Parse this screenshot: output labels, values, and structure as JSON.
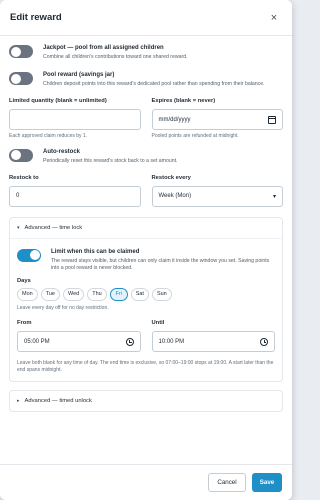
{
  "dialog": {
    "title": "Edit reward",
    "close_glyph": "×"
  },
  "jackpot": {
    "label": "Jackpot — pool from all assigned children",
    "description": "Combine all children's contributions toward one shared reward.",
    "on": false
  },
  "pool": {
    "label": "Pool reward (savings jar)",
    "description": "Children deposit points into this reward's dedicated pool rather than spending from their balance.",
    "on": false
  },
  "limited": {
    "label": "Limited quantity (blank = unlimited)",
    "value": "",
    "hint": "Each approved claim reduces by 1."
  },
  "expires": {
    "label": "Expires (blank = never)",
    "value": "mm/dd/yyyy",
    "hint": "Pooled points are refunded at midnight."
  },
  "autorestock": {
    "label": "Auto-restock",
    "description": "Periodically reset this reward's stock back to a set amount.",
    "on": false
  },
  "restock_to": {
    "label": "Restock to",
    "value": "0"
  },
  "restock_every": {
    "label": "Restock every",
    "value": "Week (Mon)"
  },
  "time_lock": {
    "header": "Advanced — time lock",
    "limit_label": "Limit when this can be claimed",
    "limit_description": "The reward stays visible, but children can only claim it inside the window you set. Saving points into a pool reward is never blocked.",
    "limit_on": true,
    "days_label": "Days",
    "days": [
      {
        "label": "Mon",
        "selected": false
      },
      {
        "label": "Tue",
        "selected": false
      },
      {
        "label": "Wed",
        "selected": false
      },
      {
        "label": "Thu",
        "selected": false
      },
      {
        "label": "Fri",
        "selected": true
      },
      {
        "label": "Sat",
        "selected": false
      },
      {
        "label": "Sun",
        "selected": false
      }
    ],
    "days_hint": "Leave every day off for no day restriction.",
    "from_label": "From",
    "from_value": "05:00 PM",
    "until_label": "Until",
    "until_value": "10:00 PM",
    "window_hint": "Leave both blank for any time of day. The end time is exclusive, so 07:00–19:00 stops at 19:00. A start later than the end spans midnight."
  },
  "timed_unlock": {
    "header": "Advanced — timed unlock"
  },
  "footer": {
    "cancel": "Cancel",
    "save": "Save"
  },
  "colors": {
    "accent": "#1e8fc7",
    "toggle_off": "#6b7280"
  }
}
